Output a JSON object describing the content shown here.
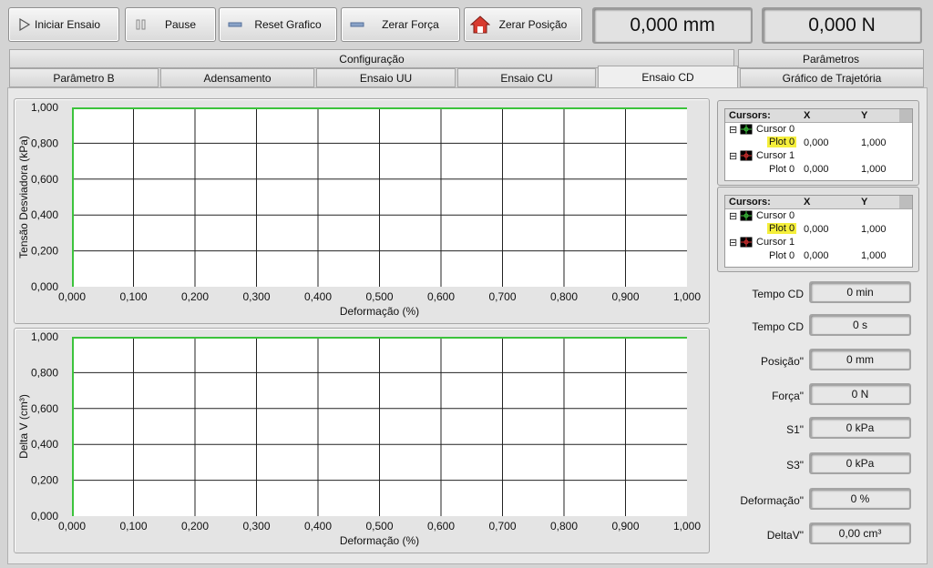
{
  "toolbar": {
    "start_label": "Iniciar Ensaio",
    "pause_label": "Pause",
    "reset_graph_label": "Reset Grafico",
    "zero_force_label": "Zerar Força",
    "zero_position_label": "Zerar Posição",
    "position_display": "0,000 mm",
    "force_display": "0,000 N"
  },
  "tabs": {
    "top_row": [
      "Configuração",
      "Parâmetros"
    ],
    "bottom_row": [
      "Parâmetro B",
      "Adensamento",
      "Ensaio UU",
      "Ensaio CU",
      "Ensaio CD",
      "Gráfico de Trajetória"
    ],
    "active": "Ensaio CD"
  },
  "chart_data": [
    {
      "type": "line",
      "xlabel": "Deformação (%)",
      "ylabel": "Tensão Desviadora (kPa)",
      "xlim": [
        0,
        1
      ],
      "ylim": [
        0,
        1
      ],
      "xticks": [
        "0,000",
        "0,100",
        "0,200",
        "0,300",
        "0,400",
        "0,500",
        "0,600",
        "0,700",
        "0,800",
        "0,900",
        "1,000"
      ],
      "yticks": [
        "0,000",
        "0,200",
        "0,400",
        "0,600",
        "0,800",
        "1,000"
      ],
      "grid": true,
      "series": [],
      "line_color": "#3cc33c"
    },
    {
      "type": "line",
      "xlabel": "Deformação (%)",
      "ylabel": "Delta V (cm³)",
      "xlim": [
        0,
        1
      ],
      "ylim": [
        0,
        1
      ],
      "xticks": [
        "0,000",
        "0,100",
        "0,200",
        "0,300",
        "0,400",
        "0,500",
        "0,600",
        "0,700",
        "0,800",
        "0,900",
        "1,000"
      ],
      "yticks": [
        "0,000",
        "0,200",
        "0,400",
        "0,600",
        "0,800",
        "1,000"
      ],
      "grid": true,
      "series": [],
      "line_color": "#3cc33c"
    }
  ],
  "cursor_panels": [
    {
      "header": [
        "Cursors:",
        "X",
        "Y"
      ],
      "rows": [
        {
          "name": "Cursor 0",
          "plot": "Plot 0",
          "x": "0,000",
          "y": "1,000",
          "highlight": true
        },
        {
          "name": "Cursor 1",
          "plot": "Plot 0",
          "x": "0,000",
          "y": "1,000",
          "highlight": false
        }
      ]
    },
    {
      "header": [
        "Cursors:",
        "X",
        "Y"
      ],
      "rows": [
        {
          "name": "Cursor 0",
          "plot": "Plot 0",
          "x": "0,000",
          "y": "1,000",
          "highlight": true
        },
        {
          "name": "Cursor 1",
          "plot": "Plot 0",
          "x": "0,000",
          "y": "1,000",
          "highlight": false
        }
      ]
    }
  ],
  "fields": [
    {
      "label": "Tempo CD",
      "value": "0 min"
    },
    {
      "label": "Tempo CD",
      "value": "0 s"
    },
    {
      "label": "Posição\"",
      "value": "0 mm"
    },
    {
      "label": "Força\"",
      "value": "0 N"
    },
    {
      "label": "S1\"",
      "value": "0 kPa"
    },
    {
      "label": "S3\"",
      "value": "0 kPa"
    },
    {
      "label": "Deformação\"",
      "value": "0 %"
    },
    {
      "label": "DeltaV\"",
      "value": "0,00 cm³"
    }
  ]
}
